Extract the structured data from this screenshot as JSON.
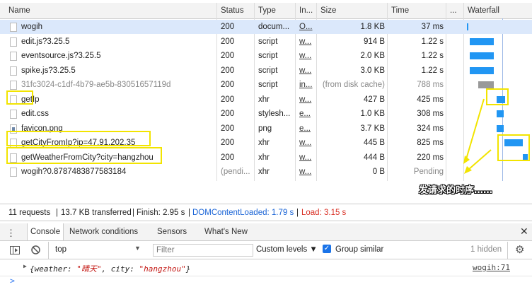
{
  "columns": {
    "name": "Name",
    "status": "Status",
    "type": "Type",
    "initiator": "In...",
    "size": "Size",
    "time": "Time",
    "more": "...",
    "waterfall": "Waterfall"
  },
  "rows": [
    {
      "name": "wogih",
      "status": "200",
      "type": "docum...",
      "initiator": "O...",
      "size": "1.8 KB",
      "time": "37 ms"
    },
    {
      "name": "edit.js?3.25.5",
      "status": "200",
      "type": "script",
      "initiator": "w...",
      "size": "914 B",
      "time": "1.22 s"
    },
    {
      "name": "eventsource.js?3.25.5",
      "status": "200",
      "type": "script",
      "initiator": "w...",
      "size": "2.0 KB",
      "time": "1.22 s"
    },
    {
      "name": "spike.js?3.25.5",
      "status": "200",
      "type": "script",
      "initiator": "w...",
      "size": "3.0 KB",
      "time": "1.22 s"
    },
    {
      "name": "31fc3024-c1df-4b79-ae5b-83051657119d",
      "status": "200",
      "type": "script",
      "initiator": "in...",
      "size": "(from disk cache)",
      "time": "788 ms"
    },
    {
      "name": "getIp",
      "status": "200",
      "type": "xhr",
      "initiator": "w...",
      "size": "427 B",
      "time": "425 ms"
    },
    {
      "name": "edit.css",
      "status": "200",
      "type": "stylesh...",
      "initiator": "e...",
      "size": "1.0 KB",
      "time": "308 ms"
    },
    {
      "name": "favicon.png",
      "status": "200",
      "type": "png",
      "initiator": "e...",
      "size": "3.7 KB",
      "time": "324 ms"
    },
    {
      "name": "getCityFromIp?ip=47.91.202.35",
      "status": "200",
      "type": "xhr",
      "initiator": "w...",
      "size": "445 B",
      "time": "825 ms"
    },
    {
      "name": "getWeatherFromCity?city=hangzhou",
      "status": "200",
      "type": "xhr",
      "initiator": "w...",
      "size": "444 B",
      "time": "220 ms"
    },
    {
      "name": "wogih?0.8787483877583184",
      "status": "(pendi...",
      "type": "xhr",
      "initiator": "w...",
      "size": "0 B",
      "time": "Pending"
    }
  ],
  "summary": {
    "requests": "11 requests",
    "transferred": "13.7 KB transferred",
    "finish": "Finish: 2.95 s",
    "dcl": "DOMContentLoaded: 1.79 s",
    "load": "Load: 3.15 s",
    "sep": "|"
  },
  "annotation": "发请求的时序……",
  "drawer_tabs": [
    "Console",
    "Network conditions",
    "Sensors",
    "What's New"
  ],
  "toolbar": {
    "context": "top",
    "filter_placeholder": "Filter",
    "levels": "Custom levels ▼",
    "group_similar": "Group similar",
    "hidden": "1 hidden"
  },
  "console": {
    "arrow": "▶",
    "open": "{",
    "k1": "weather: ",
    "v1": "\"晴天\"",
    "comma": ", ",
    "k2": "city: ",
    "v2": "\"hangzhou\"",
    "close": "}",
    "source": "wogih:71"
  },
  "prompt": ">",
  "colors": {
    "dcl": "#1a64d6",
    "load": "#d93025",
    "bar": "#2196f3",
    "highlight": "#f2e400"
  }
}
